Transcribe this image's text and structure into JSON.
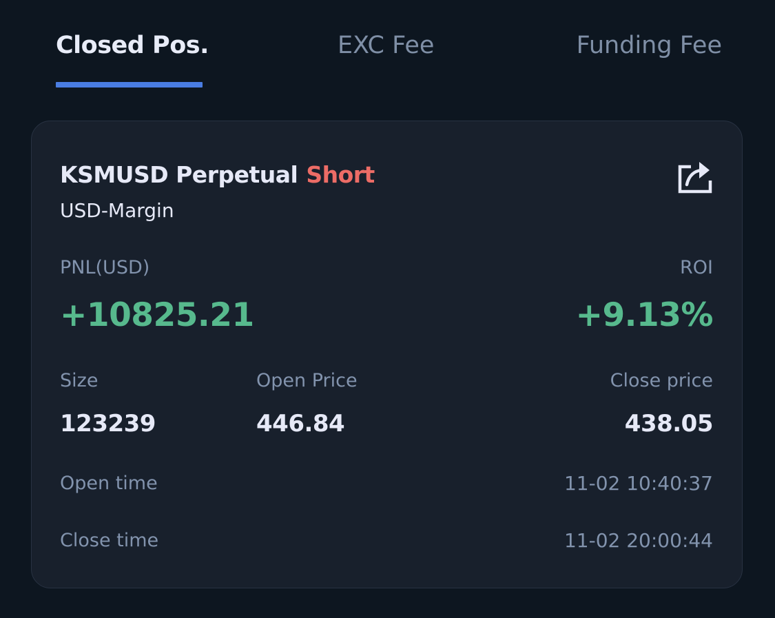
{
  "tabs": [
    {
      "label": "Closed Pos.",
      "active": true
    },
    {
      "label": "EXC Fee",
      "active": false
    },
    {
      "label": "Funding Fee",
      "active": false
    }
  ],
  "position": {
    "symbol": "KSMUSD Perpetual",
    "side": "Short",
    "margin_type": "USD-Margin",
    "share_icon": "share-icon",
    "pnl_label": "PNL(USD)",
    "pnl_value": "+10825.21",
    "roi_label": "ROI",
    "roi_value": "+9.13%",
    "size_label": "Size",
    "size_value": "123239",
    "open_price_label": "Open Price",
    "open_price_value": "446.84",
    "close_price_label": "Close price",
    "close_price_value": "438.05",
    "open_time_label": "Open time",
    "open_time_value": "11-02 10:40:37",
    "close_time_label": "Close time",
    "close_time_value": "11-02 20:00:44"
  },
  "colors": {
    "background": "#0d1620",
    "card": "#18202c",
    "accent": "#4a7de2",
    "profit": "#57b98d",
    "short": "#ec6c66"
  }
}
